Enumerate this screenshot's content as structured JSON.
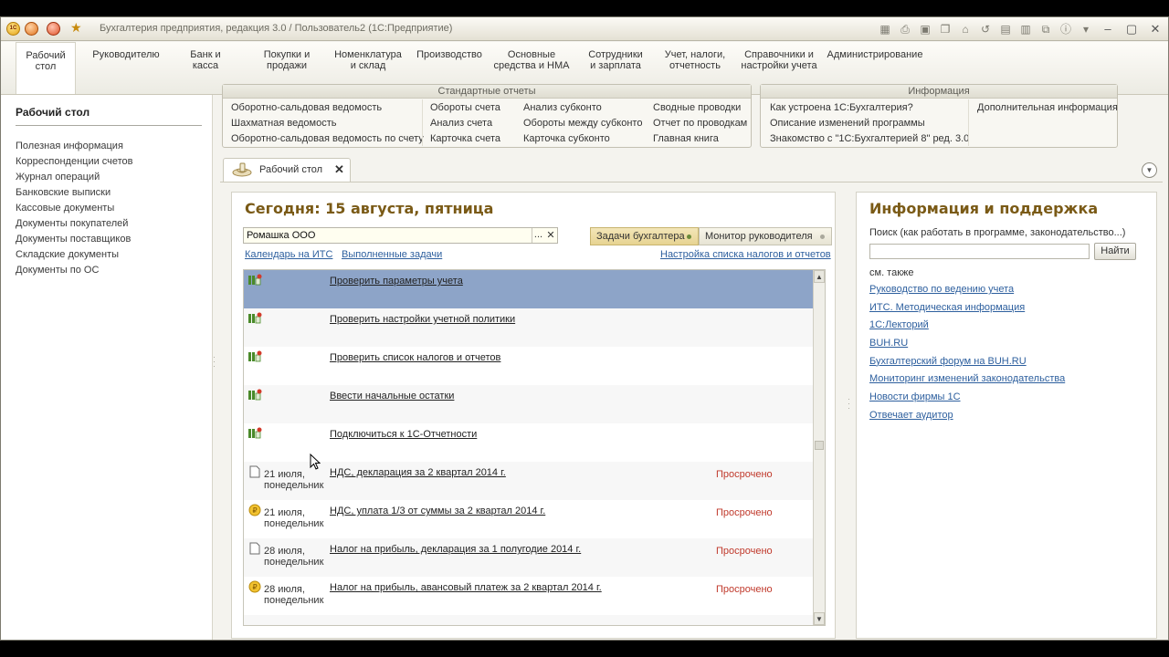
{
  "window": {
    "title": "Бухгалтерия предприятия, редакция 3.0 / Пользователь2 (1С:Предприятие)",
    "logo_text": "1С"
  },
  "sections": [
    {
      "label": "Рабочий\nстол",
      "active": true
    },
    {
      "label": "Руководителю"
    },
    {
      "label": "Банк и\nкасса"
    },
    {
      "label": "Покупки и\nпродажи"
    },
    {
      "label": "Номенклатура\nи склад"
    },
    {
      "label": "Производство"
    },
    {
      "label": "Основные\nсредства и НМА"
    },
    {
      "label": "Сотрудники\nи зарплата"
    },
    {
      "label": "Учет, налоги,\nотчетность"
    },
    {
      "label": "Справочники и\nнастройки учета"
    },
    {
      "label": "Администрирование"
    }
  ],
  "sidebar": {
    "title": "Рабочий стол",
    "items": [
      "Полезная информация",
      "Корреспонденции счетов",
      "Журнал операций",
      "Банковские выписки",
      "Кассовые документы",
      "Документы покупателей",
      "Документы поставщиков",
      "Складские документы",
      "Документы по ОС"
    ]
  },
  "standard_reports": {
    "title": "Стандартные отчеты",
    "col1": [
      "Оборотно-сальдовая ведомость",
      "Шахматная ведомость",
      "Оборотно-сальдовая ведомость по счету"
    ],
    "col2": [
      "Обороты счета",
      "Анализ счета",
      "Карточка счета"
    ],
    "col3": [
      "Анализ субконто",
      "Обороты между субконто",
      "Карточка субконто"
    ],
    "col4": [
      "Сводные проводки",
      "Отчет по проводкам",
      "Главная книга"
    ]
  },
  "information": {
    "title": "Информация",
    "col1": [
      "Как устроена 1С:Бухгалтерия?",
      "Описание изменений программы",
      "Знакомство с \"1С:Бухгалтерией 8\" ред. 3.0"
    ],
    "col2": [
      "Дополнительная информация"
    ]
  },
  "tab": {
    "label": "Рабочий стол",
    "close": "✕"
  },
  "main": {
    "today": "Сегодня: 15 августа, пятница",
    "organization": "Ромашка ООО",
    "dots": "...",
    "clear": "✕",
    "segments": [
      "Задачи бухгалтера",
      "Монитор руководителя"
    ],
    "links": {
      "calendar": "Календарь на ИТС",
      "done": "Выполненные задачи",
      "settings": "Настройка списка налогов и отчетов"
    },
    "tasks": [
      {
        "date": "",
        "text": "Проверить параметры учета",
        "status": "",
        "icon": "task-icon",
        "selected": true
      },
      {
        "date": "",
        "text": "Проверить настройки учетной политики",
        "status": "",
        "icon": "task-icon"
      },
      {
        "date": "",
        "text": "Проверить список налогов и отчетов",
        "status": "",
        "icon": "task-icon"
      },
      {
        "date": "",
        "text": "Ввести начальные остатки",
        "status": "",
        "icon": "task-icon"
      },
      {
        "date": "",
        "text": "Подключиться к 1С-Отчетности",
        "status": "",
        "icon": "task-icon"
      },
      {
        "date": "21 июля,\nпонедельник",
        "text": "НДС, декларация за 2 квартал 2014 г.",
        "status": "Просрочено",
        "icon": "document-icon"
      },
      {
        "date": "21 июля,\nпонедельник",
        "text": "НДС, уплата 1/3 от суммы за 2 квартал 2014 г.",
        "status": "Просрочено",
        "icon": "payment-icon"
      },
      {
        "date": "28 июля,\nпонедельник",
        "text": "Налог на прибыль, декларация за 1 полугодие 2014 г.",
        "status": "Просрочено",
        "icon": "document-icon"
      },
      {
        "date": "28 июля,\nпонедельник",
        "text": "Налог на прибыль, авансовый платеж за 2 квартал 2014 г.",
        "status": "Просрочено",
        "icon": "payment-icon"
      }
    ]
  },
  "info_panel": {
    "title": "Информация и поддержка",
    "search_hint": "Поиск (как работать в программе, законодательство...)",
    "search_value": "",
    "search_button": "Найти",
    "see_also": "см. также",
    "links": [
      "Руководство по ведению учета",
      "ИТС. Методическая информация",
      "1С:Лекторий",
      "BUH.RU",
      "Бухгалтерский форум на BUH.RU",
      "Мониторинг изменений законодательства",
      "Новости фирмы 1С",
      "Отвечает аудитор"
    ]
  },
  "colors": {
    "accent_title": "#7a5a16",
    "link": "#2d5f9e",
    "overdue": "#c0392b",
    "selection": "#8da4c8"
  }
}
